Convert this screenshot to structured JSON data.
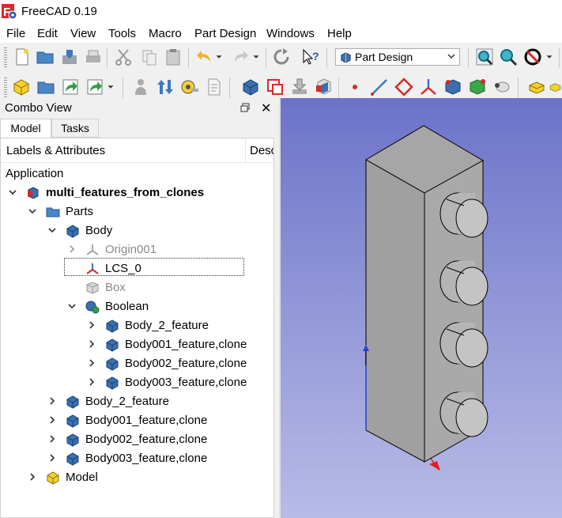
{
  "window": {
    "title": "FreeCAD 0.19"
  },
  "menu": [
    "File",
    "Edit",
    "View",
    "Tools",
    "Macro",
    "Part Design",
    "Windows",
    "Help"
  ],
  "workbench_selector": {
    "value": "Part Design"
  },
  "combo_view": {
    "title": "Combo View",
    "tabs": [
      "Model",
      "Tasks"
    ],
    "header": {
      "labels": "Labels & Attributes",
      "desc": "Desc"
    }
  },
  "tree": {
    "application": "Application",
    "document": "multi_features_from_clones",
    "parts": "Parts",
    "body": "Body",
    "origin": "Origin001",
    "lcs": "LCS_0",
    "box": "Box",
    "boolean": "Boolean",
    "boolean_children": [
      "Body_2_feature",
      "Body001_feature,clone",
      "Body002_feature,clone",
      "Body003_feature,clone"
    ],
    "part_children": [
      "Body_2_feature",
      "Body001_feature,clone",
      "Body002_feature,clone",
      "Body003_feature,clone"
    ],
    "model": "Model"
  },
  "colors": {
    "viewport_top": "#6b73c9",
    "viewport_bottom": "#b8bbe7",
    "body_blue": "#3a6fb0",
    "solid_grey": "#a9a9a9"
  }
}
